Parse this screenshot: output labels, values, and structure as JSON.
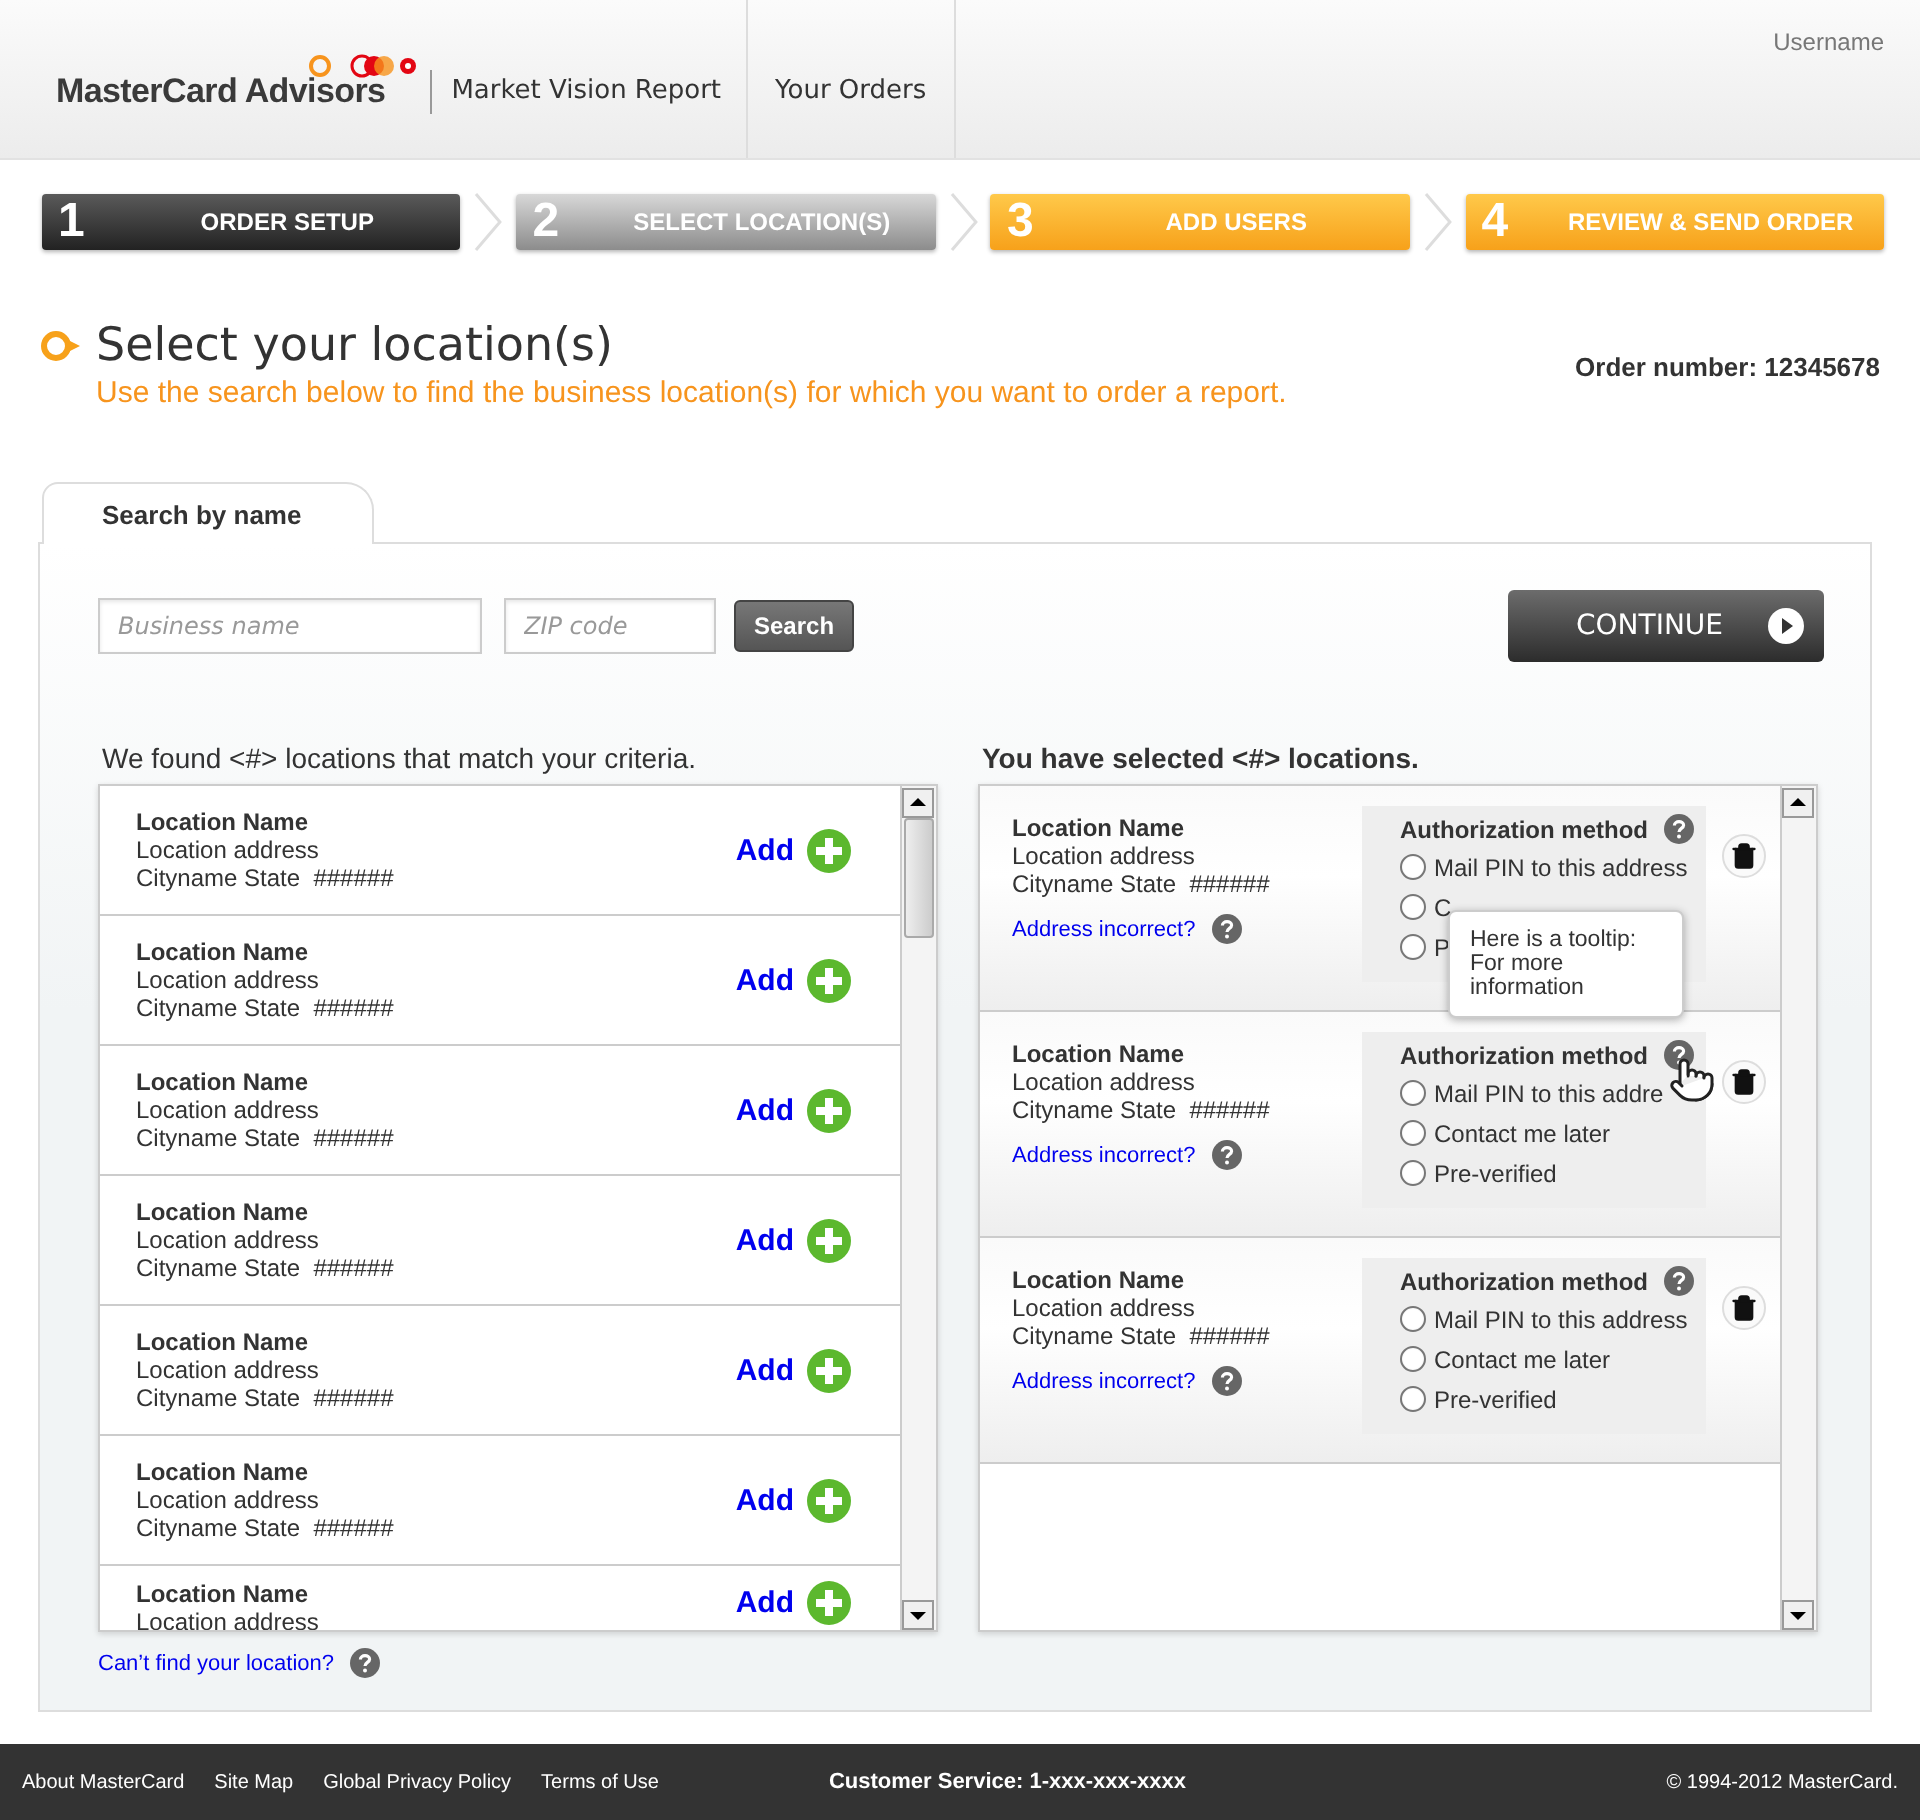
{
  "header": {
    "logo": "MasterCard Advisors",
    "product": "Market Vision Report",
    "nav": [
      "Your Orders"
    ],
    "user": "Username"
  },
  "steps": [
    {
      "number": "1",
      "label": "ORDER SETUP",
      "kind": "done"
    },
    {
      "number": "2",
      "label": "SELECT LOCATION(S)",
      "kind": "current"
    },
    {
      "number": "3",
      "label": "ADD USERS",
      "kind": "upcoming"
    },
    {
      "number": "4",
      "label": "REVIEW & SEND ORDER",
      "kind": "upcoming"
    }
  ],
  "page": {
    "title": "Select your location(s)",
    "subtitle": "Use the search below to find the business location(s) for which you want to order a report.",
    "order_number": "Order number: 12345678"
  },
  "search": {
    "tab": "Search by name",
    "fields": [
      {
        "placeholder": "Business name"
      },
      {
        "placeholder": "ZIP code"
      }
    ],
    "button": "Search",
    "continue": "CONTINUE"
  },
  "results": {
    "heading": "We found <#> locations that match your criteria.",
    "help_link": "Can’t find your location?",
    "items": [
      {
        "name": "Location Name",
        "address": "Location address",
        "city": "Cityname State  ######",
        "add": "Add"
      },
      {
        "name": "Location Name",
        "address": "Location address",
        "city": "Cityname State  ######",
        "add": "Add"
      },
      {
        "name": "Location Name",
        "address": "Location address",
        "city": "Cityname State  ######",
        "add": "Add"
      },
      {
        "name": "Location Name",
        "address": "Location address",
        "city": "Cityname State  ######",
        "add": "Add"
      },
      {
        "name": "Location Name",
        "address": "Location address",
        "city": "Cityname State  ######",
        "add": "Add"
      },
      {
        "name": "Location Name",
        "address": "Location address",
        "city": "Cityname State  ######",
        "add": "Add"
      },
      {
        "name": "Location Name",
        "address": "Location address",
        "add": "Add"
      }
    ]
  },
  "selected": {
    "heading": "You have selected <#> locations.",
    "items": [
      {
        "name": "Location Name",
        "address": "Location address",
        "city": "Cityname State  ######",
        "link": "Address incorrect?",
        "auth_title": "Authorization method",
        "hovered": false,
        "tooltip": "Here is a tooltip: For more information",
        "options": [
          {
            "label": "Mail PIN to this address",
            "selected": false
          },
          {
            "label": "C",
            "selected": false
          },
          {
            "label": "P",
            "selected": false
          }
        ]
      },
      {
        "name": "Location Name",
        "address": "Location address",
        "city": "Cityname State  ######",
        "link": "Address incorrect?",
        "auth_title": "Authorization method",
        "hovered": true,
        "options": [
          {
            "label": "Mail PIN to this addre",
            "selected": false
          },
          {
            "label": "Contact me later",
            "selected": false
          },
          {
            "label": "Pre-verified",
            "selected": false
          }
        ]
      },
      {
        "name": "Location Name",
        "address": "Location address",
        "city": "Cityname State  ######",
        "link": "Address incorrect?",
        "auth_title": "Authorization method",
        "hovered": false,
        "options": [
          {
            "label": "Mail PIN to this address",
            "selected": false
          },
          {
            "label": "Contact me later",
            "selected": false
          },
          {
            "label": "Pre-verified",
            "selected": false
          }
        ]
      }
    ]
  },
  "footer": {
    "links": [
      "About MasterCard",
      "Site Map",
      "Global Privacy Policy",
      "Terms of Use"
    ],
    "service": "Customer Service: 1-xxx-xxx-xxxx",
    "copyright": "© 1994-2012 MasterCard."
  }
}
